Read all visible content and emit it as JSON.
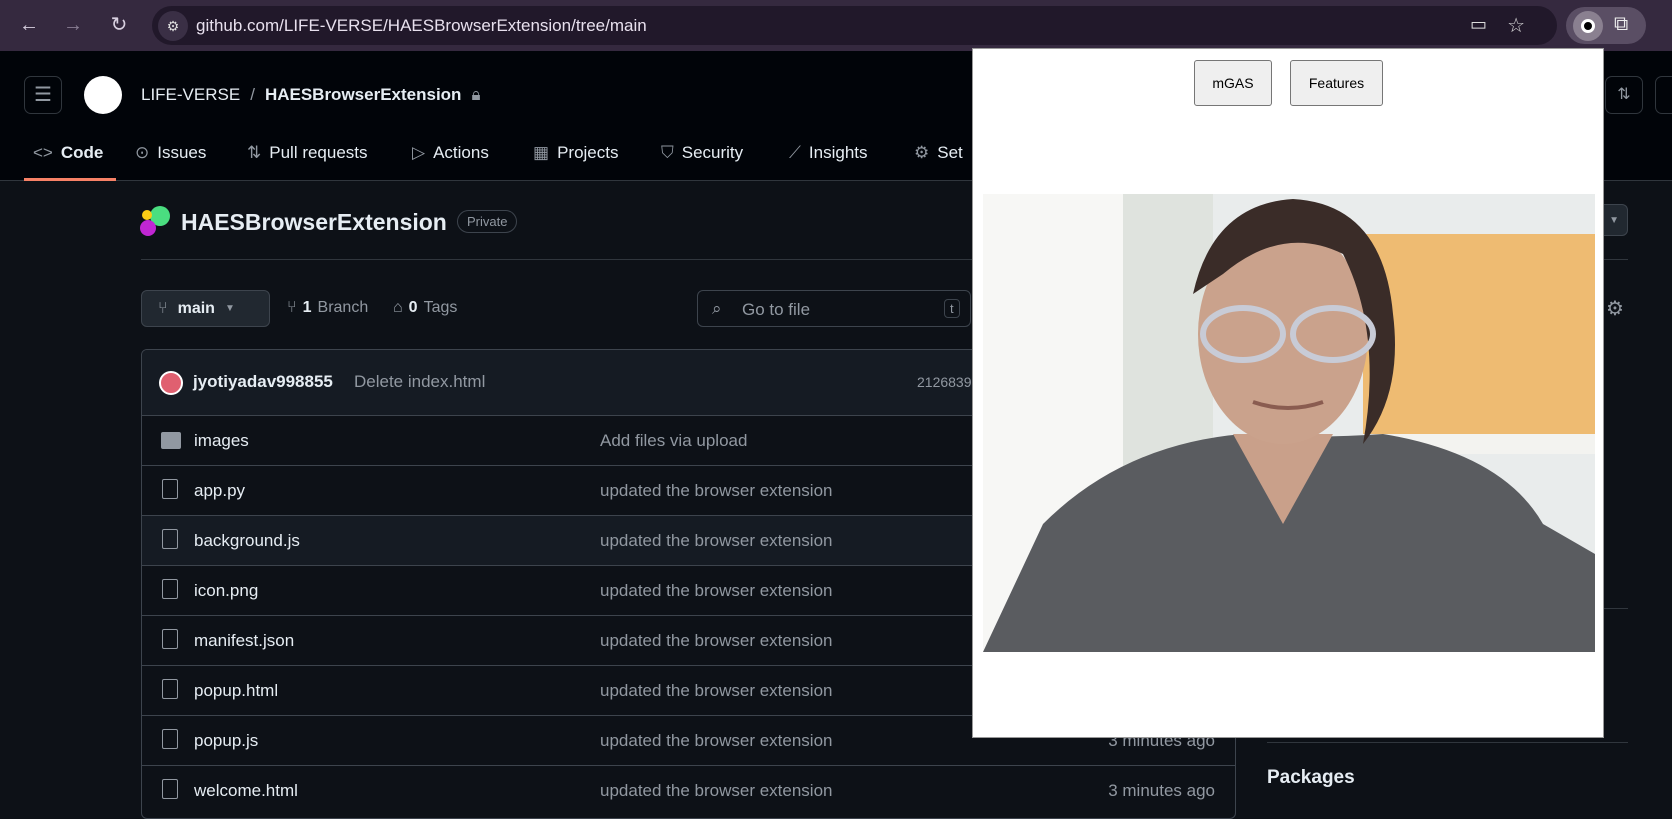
{
  "browser": {
    "url": "github.com/LIFE-VERSE/HAESBrowserExtension/tree/main",
    "icons": [
      "back-arrow-icon",
      "forward-arrow-icon",
      "reload-icon",
      "site-settings-icon",
      "install-app-icon",
      "star-icon",
      "extension-active-icon",
      "extensions-puzzle-icon"
    ]
  },
  "header": {
    "owner": "LIFE-VERSE",
    "separator": "/",
    "repo": "HAESBrowserExtension"
  },
  "tabs": [
    {
      "label": "Code",
      "icon": "code-icon"
    },
    {
      "label": "Issues",
      "icon": "issue-icon"
    },
    {
      "label": "Pull requests",
      "icon": "pull-request-icon"
    },
    {
      "label": "Actions",
      "icon": "play-icon"
    },
    {
      "label": "Projects",
      "icon": "table-icon"
    },
    {
      "label": "Security",
      "icon": "shield-icon"
    },
    {
      "label": "Insights",
      "icon": "graph-icon"
    },
    {
      "label": "Set",
      "icon": "gear-icon"
    }
  ],
  "repo": {
    "title": "HAESBrowserExtension",
    "visibility": "Private"
  },
  "toolbar": {
    "branch": "main",
    "branch_count": "1",
    "branch_label": "Branch",
    "tag_count": "0",
    "tag_label": "Tags",
    "search_placeholder": "Go to file",
    "shortcut": "t"
  },
  "commit": {
    "author": "jyotiyadav998855",
    "message": "Delete index.html",
    "hash": "2126839"
  },
  "files": [
    {
      "name": "images",
      "type": "folder",
      "message": "Add files via upload",
      "time": ""
    },
    {
      "name": "app.py",
      "type": "file",
      "message": "updated the browser extension",
      "time": ""
    },
    {
      "name": "background.js",
      "type": "file",
      "message": "updated the browser extension",
      "time": ""
    },
    {
      "name": "icon.png",
      "type": "file",
      "message": "updated the browser extension",
      "time": ""
    },
    {
      "name": "manifest.json",
      "type": "file",
      "message": "updated the browser extension",
      "time": ""
    },
    {
      "name": "popup.html",
      "type": "file",
      "message": "updated the browser extension",
      "time": ""
    },
    {
      "name": "popup.js",
      "type": "file",
      "message": "updated the browser extension",
      "time": "3 minutes ago"
    },
    {
      "name": "welcome.html",
      "type": "file",
      "message": "updated the browser extension",
      "time": "3 minutes ago"
    }
  ],
  "sidebar": {
    "packages": "Packages"
  },
  "popup": {
    "buttons": [
      "mGAS",
      "Features"
    ]
  },
  "colors": {
    "tab_underline": "#f78166",
    "popup_bg": "#ffffff",
    "gh_bg": "#0d1117"
  }
}
